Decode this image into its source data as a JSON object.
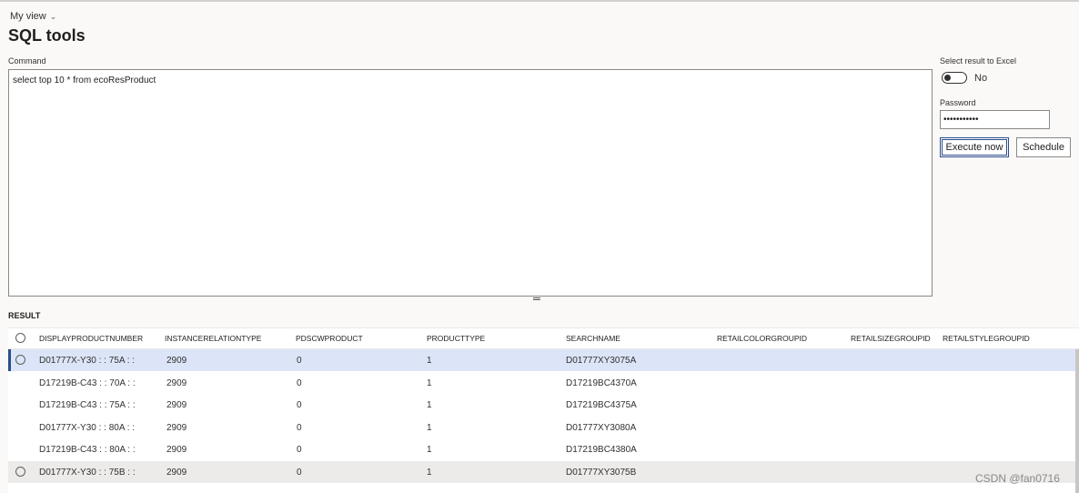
{
  "header": {
    "view_label": "My view",
    "title": "SQL tools"
  },
  "command": {
    "label": "Command",
    "value": "select top 10 * from ecoResProduct"
  },
  "excel": {
    "label": "Select result to Excel",
    "state": "No",
    "on": false
  },
  "password": {
    "label": "Password",
    "value": "•••••••••••"
  },
  "buttons": {
    "execute": "Execute now",
    "schedule": "Schedule"
  },
  "result": {
    "label": "RESULT",
    "columns": [
      "DISPLAYPRODUCTNUMBER",
      "INSTANCERELATIONTYPE",
      "PDSCWPRODUCT",
      "PRODUCTTYPE",
      "SEARCHNAME",
      "RETAILCOLORGROUPID",
      "RETAILSIZEGROUPID",
      "RETAILSTYLEGROUPID"
    ],
    "rows": [
      {
        "DISPLAYPRODUCTNUMBER": "D01777X-Y30 : : 75A : :",
        "INSTANCERELATIONTYPE": "2909",
        "PDSCWPRODUCT": "0",
        "PRODUCTTYPE": "1",
        "SEARCHNAME": "D01777XY3075A"
      },
      {
        "DISPLAYPRODUCTNUMBER": "D17219B-C43 : : 70A : :",
        "INSTANCERELATIONTYPE": "2909",
        "PDSCWPRODUCT": "0",
        "PRODUCTTYPE": "1",
        "SEARCHNAME": "D17219BC4370A"
      },
      {
        "DISPLAYPRODUCTNUMBER": "D17219B-C43 : : 75A : :",
        "INSTANCERELATIONTYPE": "2909",
        "PDSCWPRODUCT": "0",
        "PRODUCTTYPE": "1",
        "SEARCHNAME": "D17219BC4375A"
      },
      {
        "DISPLAYPRODUCTNUMBER": "D01777X-Y30 : : 80A : :",
        "INSTANCERELATIONTYPE": "2909",
        "PDSCWPRODUCT": "0",
        "PRODUCTTYPE": "1",
        "SEARCHNAME": "D01777XY3080A"
      },
      {
        "DISPLAYPRODUCTNUMBER": "D17219B-C43 : : 80A : :",
        "INSTANCERELATIONTYPE": "2909",
        "PDSCWPRODUCT": "0",
        "PRODUCTTYPE": "1",
        "SEARCHNAME": "D17219BC4380A"
      },
      {
        "DISPLAYPRODUCTNUMBER": "D01777X-Y30 : : 75B : :",
        "INSTANCERELATIONTYPE": "2909",
        "PDSCWPRODUCT": "0",
        "PRODUCTTYPE": "1",
        "SEARCHNAME": "D01777XY3075B"
      }
    ],
    "selected_row": 0,
    "hover_row": 5
  },
  "watermark": "CSDN @fan0716",
  "colors": {
    "accent": "#2b4d8a",
    "selected_row": "#dce5f7",
    "hover_row": "#edebe9",
    "background": "#faf9f8"
  }
}
